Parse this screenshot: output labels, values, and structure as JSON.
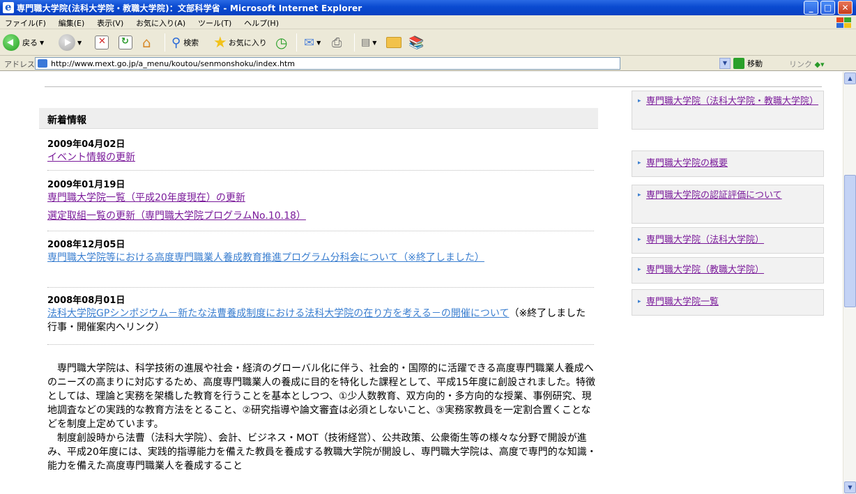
{
  "window": {
    "title": "専門職大学院(法科大学院・教職大学院)：文部科学省 - Microsoft Internet Explorer",
    "min": "_",
    "max": "□",
    "close": "✕"
  },
  "menu": [
    "ファイル(F)",
    "編集(E)",
    "表示(V)",
    "お気に入り(A)",
    "ツール(T)",
    "ヘルプ(H)"
  ],
  "toolbar": {
    "back_label": "戻る",
    "search_label": "検索",
    "favorites_label": "お気に入り"
  },
  "address": {
    "label": "アドレス(D)",
    "url": "http://www.mext.go.jp/a_menu/koutou/senmonshoku/index.htm",
    "go_label": "移動",
    "links_label": "リンク"
  },
  "news": {
    "header": "新着情報",
    "items": [
      {
        "date": "2009年04月02日",
        "links": [
          "イベント情報の更新"
        ]
      },
      {
        "date": "2009年01月19日",
        "links": [
          "専門職大学院一覧（平成20年度現在）の更新",
          "選定取組一覧の更新（専門職大学院プログラムNo.10.18）"
        ]
      },
      {
        "date": "2008年12月05日",
        "links": [
          "専門職大学院等における高度専門職業人養成教育推進プログラム分科会について（※終了しました）"
        ]
      },
      {
        "date": "2008年08月01日",
        "links": [
          "法科大学院GPシンポジウム－新たな法曹養成制度における法科大学院の在り方を考える－の開催について"
        ],
        "note": "（※終了しました　行事・開催案内へリンク）"
      }
    ]
  },
  "body_paragraphs": [
    "　専門職大学院は、科学技術の進展や社会・経済のグローバル化に伴う、社会的・国際的に活躍できる高度専門職業人養成へのニーズの高まりに対応するため、高度専門職業人の養成に目的を特化した課程として、平成15年度に創設されました。特徴としては、理論と実務を架橋した教育を行うことを基本としつつ、①少人数教育、双方向的・多方向的な授業、事例研究、現地調査などの実践的な教育方法をとること、②研究指導や論文審査は必須としないこと、③実務家教員を一定割合置くことなどを制度上定めています。",
    "　制度創設時から法曹（法科大学院）、会計、ビジネス・MOT（技術経営）、公共政策、公衆衛生等の様々な分野で開設が進み、平成20年度には、実践的指導能力を備えた教員を養成する教職大学院が開設し、専門職大学院は、高度で専門的な知識・能力を備えた高度専門職業人を養成すること"
  ],
  "sidebar": [
    "専門職大学院（法科大学院・教職大学院）",
    "専門職大学院の概要",
    "専門職大学院の認証評価について",
    "専門職大学院（法科大学院）",
    "専門職大学院（教職大学院）",
    "専門職大学院一覧"
  ],
  "scroll": {
    "up": "▲",
    "down": "▼"
  }
}
